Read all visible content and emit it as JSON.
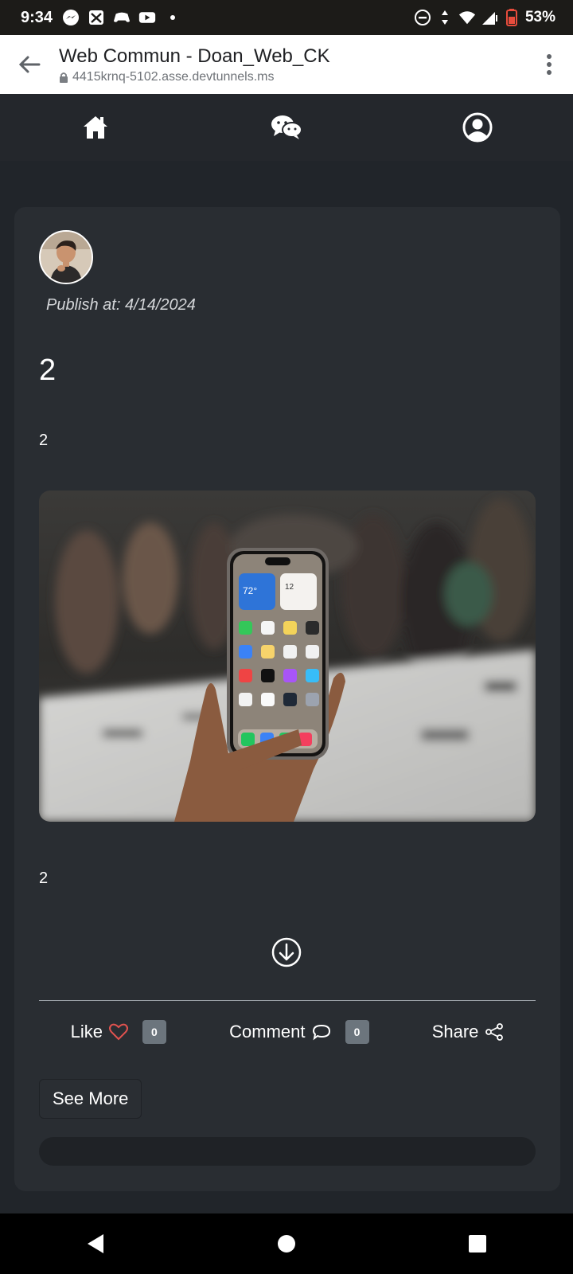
{
  "status_bar": {
    "time": "9:34",
    "battery": "53%",
    "left_icons": [
      "messenger-icon",
      "photo-icon",
      "game-controller-icon",
      "youtube-icon",
      "dot-icon"
    ],
    "right_icons": [
      "do-not-disturb-icon",
      "data-arrows-icon",
      "wifi-icon",
      "signal-icon",
      "battery-icon"
    ]
  },
  "browser": {
    "title": "Web Commun - Doan_Web_CK",
    "url": "4415krnq-5102.asse.devtunnels.ms"
  },
  "app_nav": {
    "items": [
      "home-icon",
      "chat-icon",
      "profile-icon"
    ]
  },
  "post": {
    "publish": "Publish at: 4/14/2024",
    "title": "2",
    "subtitle": "2",
    "body": "2",
    "image_alt": "Hand holding an iPhone in a crowded room"
  },
  "actions": {
    "like_label": "Like",
    "like_count": "0",
    "comment_label": "Comment",
    "comment_count": "0",
    "share_label": "Share"
  },
  "see_more_label": "See More",
  "colors": {
    "background": "#21252a",
    "card": "#292d32",
    "like_heart": "#e0524f",
    "badge": "#6c757d"
  }
}
